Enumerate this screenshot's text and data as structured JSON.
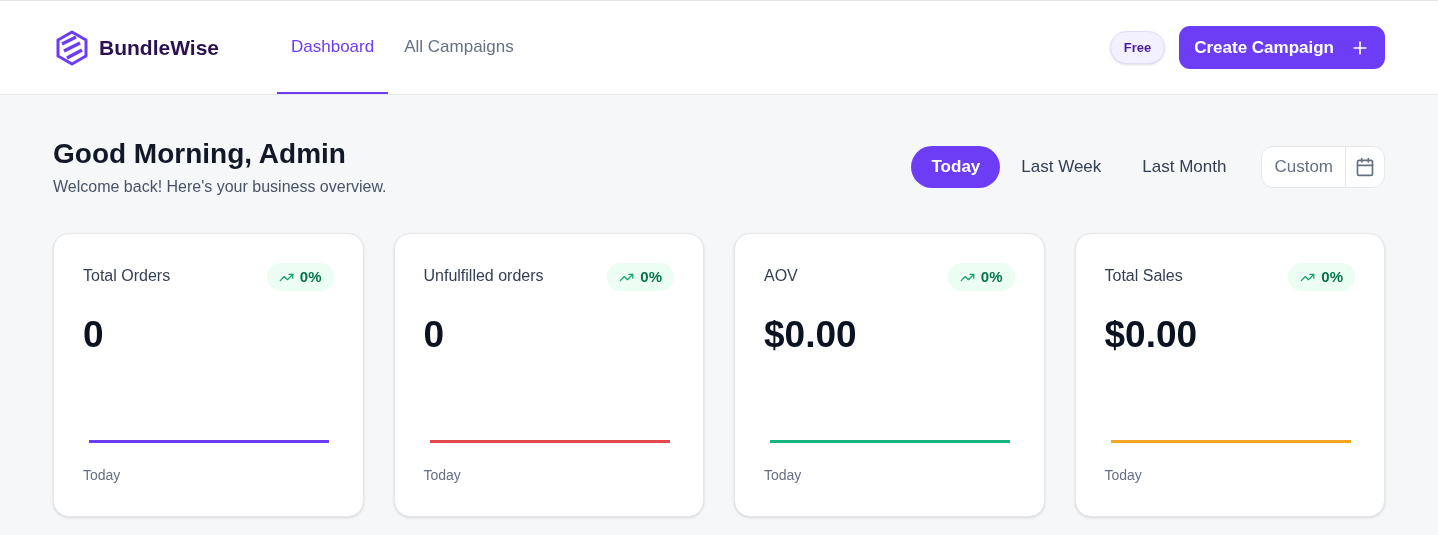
{
  "brand": {
    "name": "BundleWise"
  },
  "nav": [
    {
      "label": "Dashboard",
      "selected": true
    },
    {
      "label": "All Campaigns",
      "selected": false
    }
  ],
  "plan_badge": "Free",
  "create_button": {
    "label": "Create Campaign"
  },
  "greeting": {
    "title": "Good Morning, Admin",
    "subtitle": "Welcome back! Here's your business overview."
  },
  "ranges": [
    {
      "label": "Today",
      "selected": true
    },
    {
      "label": "Last Week",
      "selected": false
    },
    {
      "label": "Last Month",
      "selected": false
    }
  ],
  "custom_range": {
    "label": "Custom"
  },
  "cards": [
    {
      "title": "Total Orders",
      "change": "0%",
      "value": "0",
      "period": "Today",
      "color": "#6d3df5"
    },
    {
      "title": "Unfulfilled orders",
      "change": "0%",
      "value": "0",
      "period": "Today",
      "color": "#e5484d"
    },
    {
      "title": "AOV",
      "change": "0%",
      "value": "$0.00",
      "period": "Today",
      "color": "#16b47f"
    },
    {
      "title": "Total Sales",
      "change": "0%",
      "value": "$0.00",
      "period": "Today",
      "color": "#f5a524"
    }
  ]
}
